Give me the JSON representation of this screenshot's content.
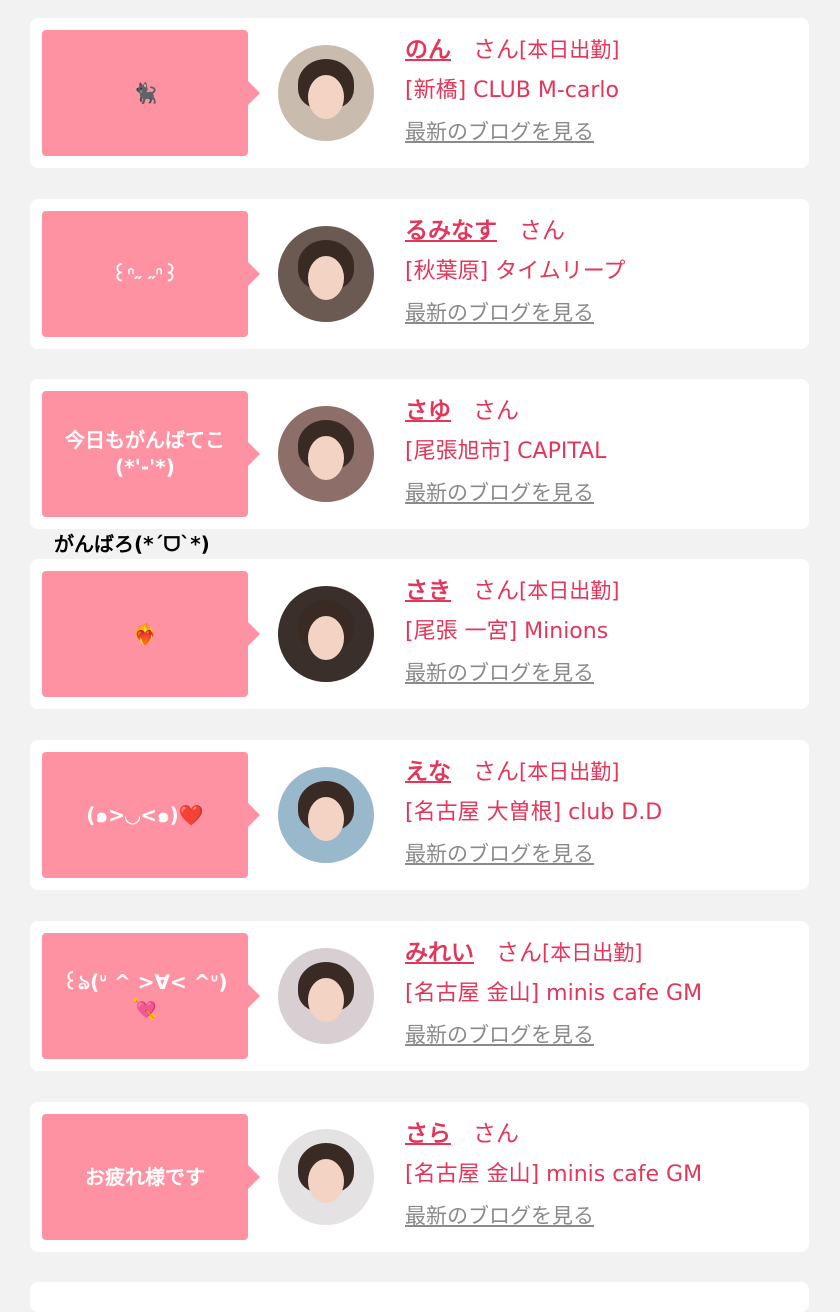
{
  "cards": [
    {
      "message": "🐈‍⬛",
      "name": "のん",
      "san": "さん",
      "status": "[本日出勤]",
      "shop": "[新橋] CLUB M-carlo",
      "blog": "最新のブログを見る",
      "avatar_bg": "#c9bcae"
    },
    {
      "message": "꒰ᐢ˶ ˶ᐢ꒱",
      "name": "るみなす",
      "san": "さん",
      "status": "",
      "shop": "[秋葉原] タイムリープ",
      "blog": "最新のブログを見る",
      "avatar_bg": "#6a5a52"
    },
    {
      "message": "今日もがんばてこ\n(*'-'*)",
      "name": "さゆ",
      "san": "さん",
      "status": "",
      "shop": "[尾張旭市] CAPITAL",
      "blog": "最新のブログを見る",
      "avatar_bg": "#8e6e68"
    },
    {
      "message": "❤️‍🔥",
      "name": "さき",
      "san": "さん",
      "status": "[本日出勤]",
      "shop": "[尾張 一宮] Minions",
      "blog": "最新のブログを見る",
      "avatar_bg": "#3a2f2b"
    },
    {
      "message": "(๑>◡<๑)❤️",
      "name": "えな",
      "san": "さん",
      "status": "[本日出勤]",
      "shop": "[名古屋 大曽根] club D.D",
      "blog": "最新のブログを見る",
      "avatar_bg": "#9ab8cc"
    },
    {
      "message": "꒰ঌ(ᐡ ^ >∀< ^ᐡ) 💘",
      "name": "みれい",
      "san": "さん",
      "status": "[本日出勤]",
      "shop": "[名古屋 金山] minis cafe GM",
      "blog": "最新のブログを見る",
      "avatar_bg": "#d8cfd3"
    },
    {
      "message": "お疲れ様です",
      "name": "さら",
      "san": "さん",
      "status": "",
      "shop": "[名古屋 金山] minis cafe GM",
      "blog": "最新のブログを見る",
      "avatar_bg": "#e4e2e2"
    }
  ],
  "floating_text": "がんばろ(*´ᗜ`*)"
}
